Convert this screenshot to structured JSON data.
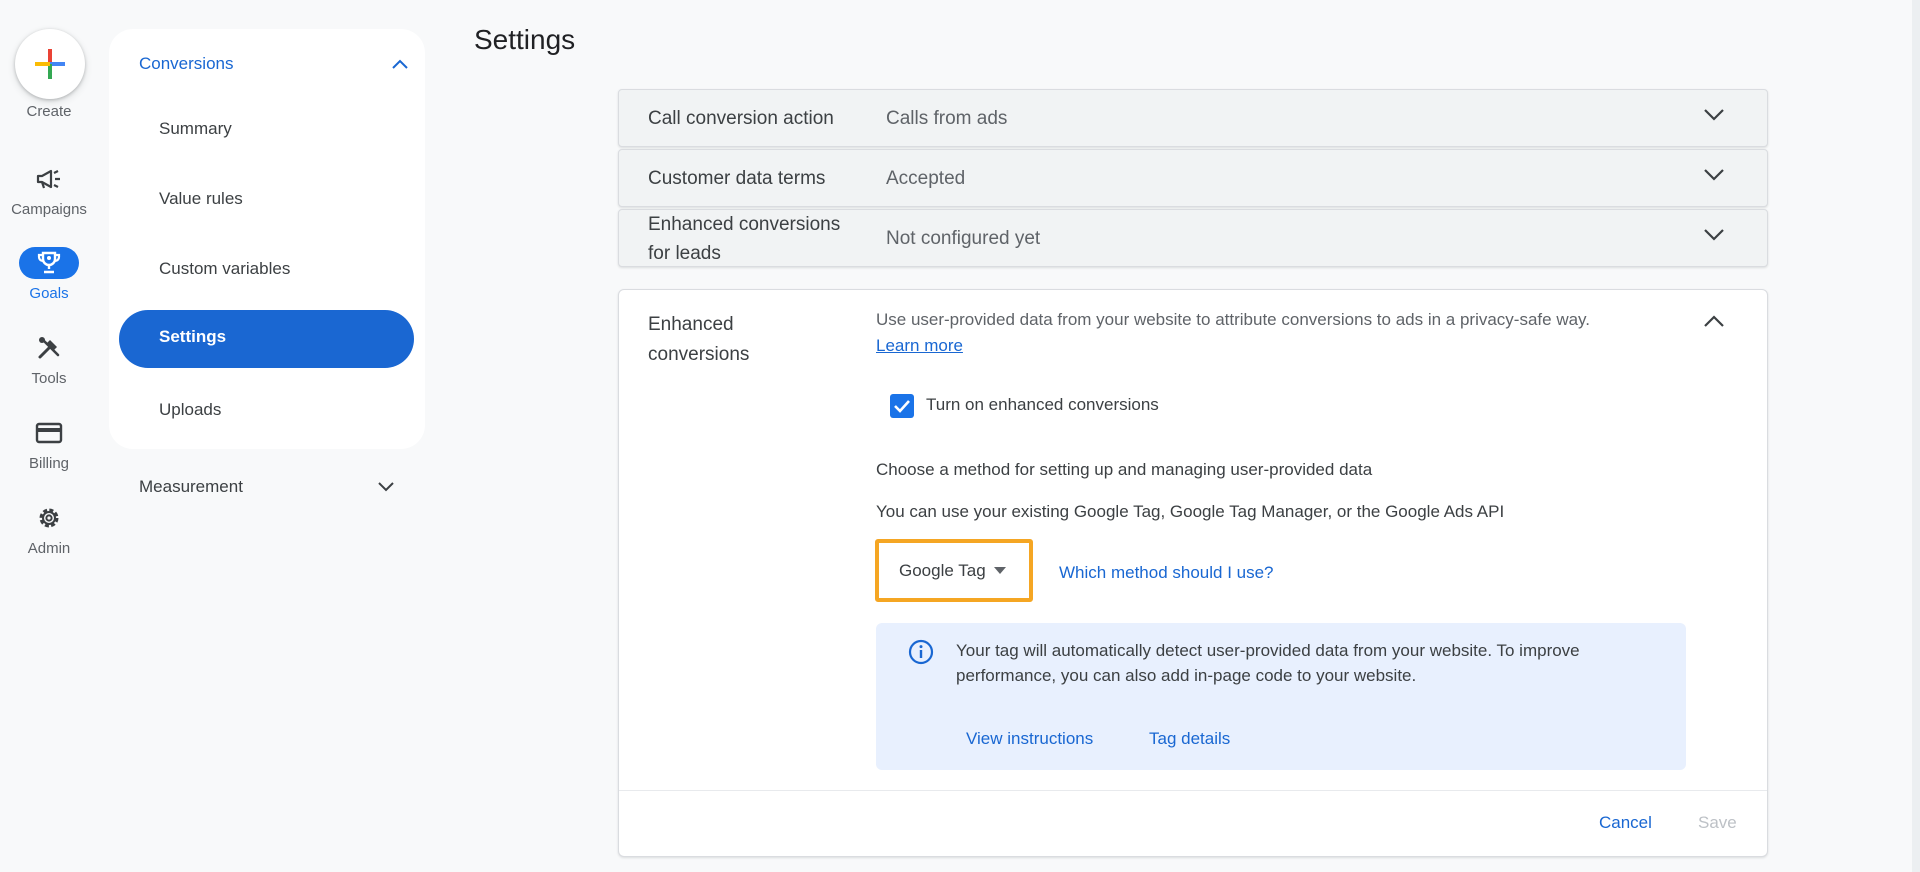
{
  "rail": {
    "create": "Create",
    "items": [
      {
        "label": "Campaigns",
        "icon": "megaphone-icon"
      },
      {
        "label": "Goals",
        "icon": "trophy-icon"
      },
      {
        "label": "Tools",
        "icon": "tools-icon"
      },
      {
        "label": "Billing",
        "icon": "credit-card-icon"
      },
      {
        "label": "Admin",
        "icon": "gear-icon"
      }
    ]
  },
  "subnav": {
    "header": "Conversions",
    "items": [
      "Summary",
      "Value rules",
      "Custom variables",
      "Settings",
      "Uploads"
    ],
    "active": "Settings",
    "measurement": "Measurement"
  },
  "page": {
    "title": "Settings"
  },
  "rows": [
    {
      "label": "Call conversion action",
      "value": "Calls from ads"
    },
    {
      "label": "Customer data terms",
      "value": "Accepted"
    },
    {
      "label_line1": "Enhanced conversions",
      "label_line2": "for leads",
      "value": "Not configured yet"
    }
  ],
  "enhanced": {
    "label_line1": "Enhanced",
    "label_line2": "conversions",
    "description": "Use user-provided data from your website to attribute conversions to ads in a privacy-safe way.",
    "learn_more": "Learn more",
    "checkbox_label": "Turn on enhanced conversions",
    "checkbox_checked": true,
    "method_text": "Choose a method for setting up and managing user-provided data",
    "api_text": "You can use your existing Google Tag, Google Tag Manager, or the Google Ads API",
    "dropdown_value": "Google Tag",
    "which_method": "Which method should I use?",
    "info_text": "Your tag will automatically detect user-provided data from your website. To improve performance, you can also add in-page code to your website.",
    "view_instructions": "View instructions",
    "tag_details": "Tag details",
    "cancel": "Cancel",
    "save": "Save"
  },
  "colors": {
    "accent": "#1a73e8",
    "highlight": "#f5a623",
    "info_bg": "#e8f0fe"
  }
}
